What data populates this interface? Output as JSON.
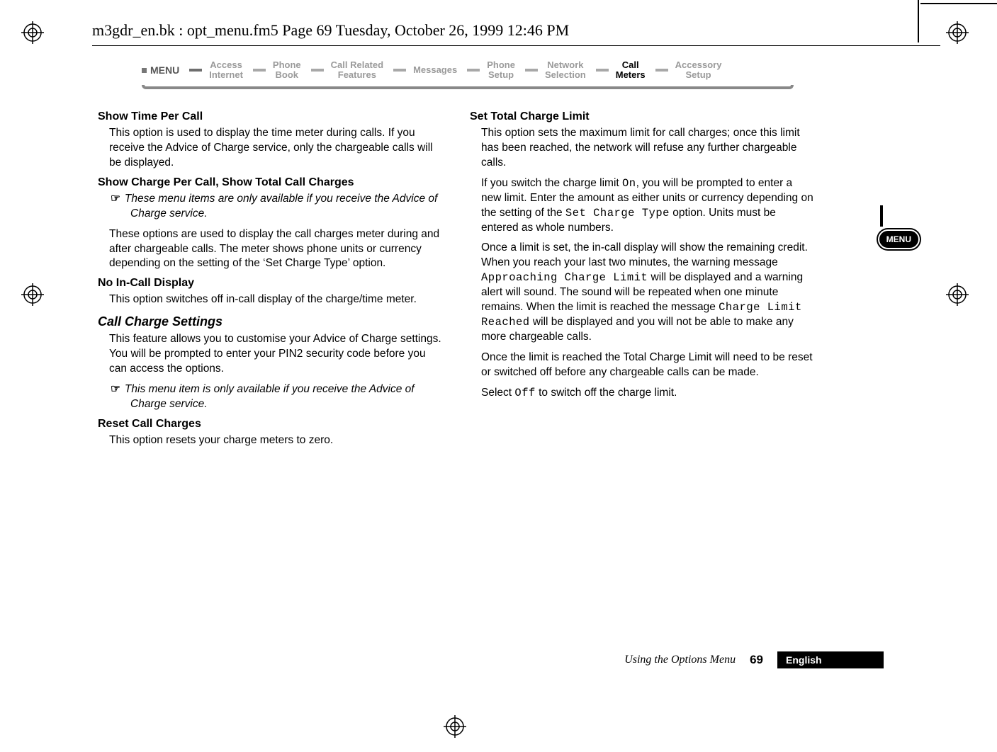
{
  "doc_header": "m3gdr_en.bk : opt_menu.fm5  Page 69  Tuesday, October 26, 1999  12:46 PM",
  "menu_lead": "MENU",
  "menu_items": [
    {
      "line1": "Access",
      "line2": "Internet",
      "active": false
    },
    {
      "line1": "Phone",
      "line2": "Book",
      "active": false
    },
    {
      "line1": "Call Related",
      "line2": "Features",
      "active": false
    },
    {
      "line1": "Messages",
      "line2": "",
      "active": false
    },
    {
      "line1": "Phone",
      "line2": "Setup",
      "active": false
    },
    {
      "line1": "Network",
      "line2": "Selection",
      "active": false
    },
    {
      "line1": "Call",
      "line2": "Meters",
      "active": true
    },
    {
      "line1": "Accessory",
      "line2": "Setup",
      "active": false
    }
  ],
  "left": {
    "h1": "Show Time Per Call",
    "p1": "This option is used to display the time meter during calls. If you receive the Advice of Charge service, only the chargeable calls will be displayed.",
    "h2": "Show Charge Per Call, Show Total Call Charges",
    "note1": "These menu items are only available if you receive the Advice of Charge service.",
    "p2": "These options are used to display the call charges meter during and after chargeable calls. The meter shows phone units or currency depending on the setting of the ‘Set Charge Type’ option.",
    "h3": "No In-Call Display",
    "p3": "This option switches off in-call display of the charge/time meter.",
    "h4": "Call Charge Settings",
    "p4": "This feature allows you to customise your Advice of Charge settings. You will be prompted to enter your PIN2 security code before you can access the options.",
    "note2": "This menu item is only available if you receive the Advice of Charge service.",
    "h5": "Reset Call Charges",
    "p5": "This option resets your charge meters to zero."
  },
  "right": {
    "h1": "Set Total Charge Limit",
    "p1": "This option sets the maximum limit for call charges; once this limit has been reached, the network will refuse any further chargeable calls.",
    "p2a": "If you switch the charge limit ",
    "p2on": "On",
    "p2b": ", you will be prompted to enter a new limit. Enter the amount as either units or currency depending on the setting of the ",
    "p2c": "Set Charge Type",
    "p2d": " option. Units must be entered as whole numbers.",
    "p3a": "Once a limit is set, the in-call display will show the remaining credit. When you reach your last two minutes, the warning message ",
    "p3b": "Approaching Charge Limit",
    "p3c": " will be displayed and a warning alert will sound. The sound will be repeated when one minute remains. When the limit is reached the message ",
    "p3d": "Charge Limit Reached",
    "p3e": " will be displayed and you will not be able to make any more chargeable calls.",
    "p4": "Once the limit is reached the Total Charge Limit will need to be reset or switched off before any chargeable calls can be made.",
    "p5a": "Select ",
    "p5b": "Off",
    "p5c": " to switch off the charge limit."
  },
  "side_tab": "MENU",
  "footer": {
    "title": "Using the Options Menu",
    "page": "69",
    "lang": "English"
  },
  "note_icon": "☞"
}
